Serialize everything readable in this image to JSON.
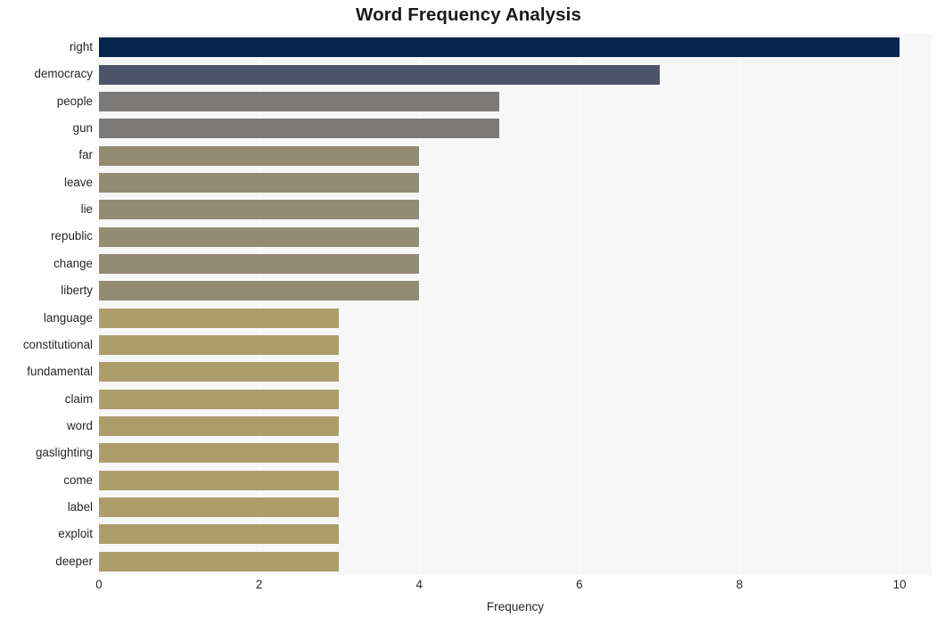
{
  "chart_data": {
    "type": "bar",
    "orientation": "horizontal",
    "title": "Word Frequency Analysis",
    "xlabel": "Frequency",
    "ylabel": "",
    "categories": [
      "right",
      "democracy",
      "people",
      "gun",
      "far",
      "leave",
      "lie",
      "republic",
      "change",
      "liberty",
      "language",
      "constitutional",
      "fundamental",
      "claim",
      "word",
      "gaslighting",
      "come",
      "label",
      "exploit",
      "deeper"
    ],
    "values": [
      10,
      7,
      5,
      5,
      4,
      4,
      4,
      4,
      4,
      4,
      3,
      3,
      3,
      3,
      3,
      3,
      3,
      3,
      3,
      3
    ],
    "bar_colors": [
      "#06254f",
      "#4b5469",
      "#7c7a78",
      "#7c7a78",
      "#938c73",
      "#938c73",
      "#938c73",
      "#938c73",
      "#938c73",
      "#938c73",
      "#ad9d6b",
      "#ad9d6b",
      "#ad9d6b",
      "#ad9d6b",
      "#ad9d6b",
      "#ad9d6b",
      "#ad9d6b",
      "#ad9d6b",
      "#ad9d6b",
      "#ad9d6b"
    ],
    "xticks": [
      0,
      2,
      4,
      6,
      8,
      10
    ],
    "xtick_labels": [
      "0",
      "2",
      "4",
      "6",
      "8",
      "10"
    ],
    "xlim": [
      0,
      10.4
    ],
    "grid": true,
    "grid_axis": "x",
    "legend": null,
    "plot_background": "#f7f7f8",
    "figure_background": "#ffffff"
  }
}
